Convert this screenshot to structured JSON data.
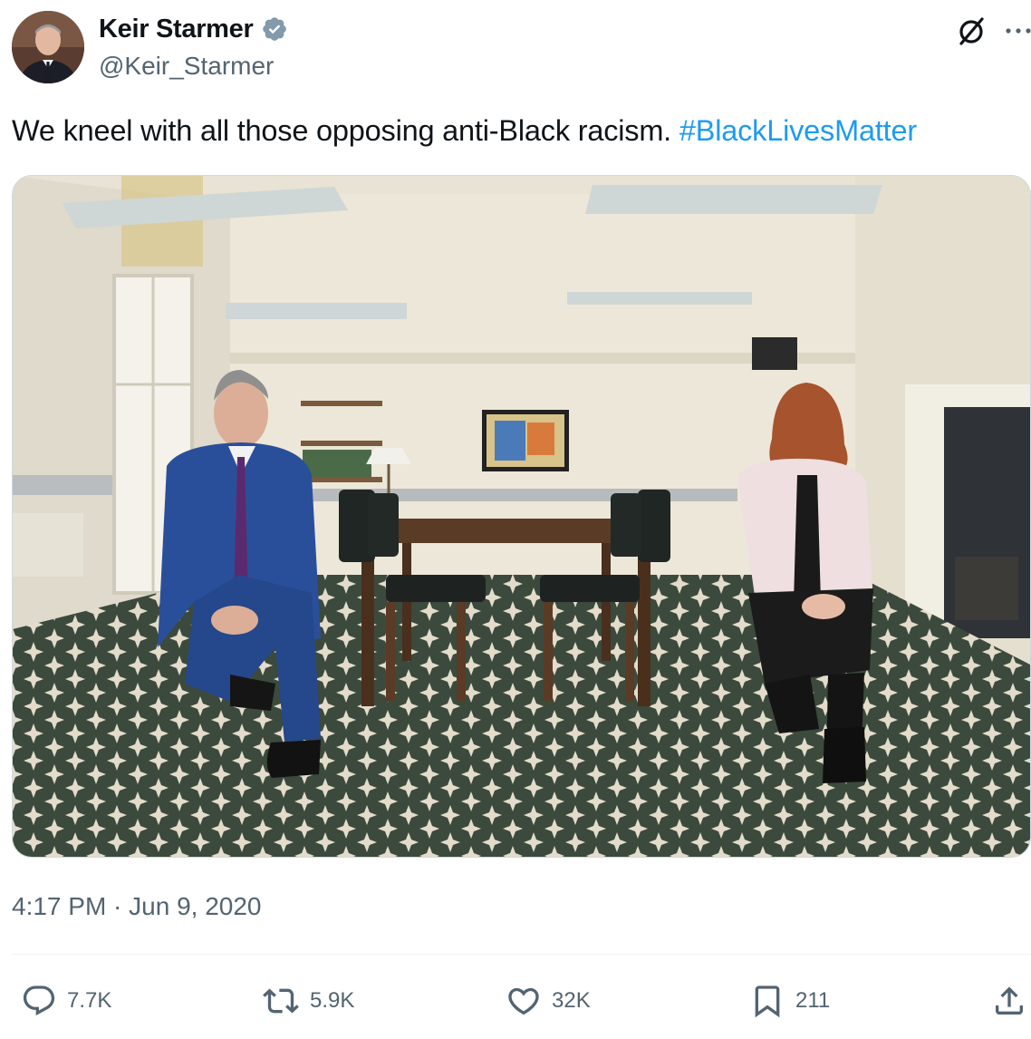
{
  "author": {
    "display_name": "Keir Starmer",
    "handle": "@Keir_Starmer",
    "verified_icon": "verified-badge-icon"
  },
  "header_actions": {
    "grok_icon": "slashed-circle-icon",
    "more_icon": "ellipsis-icon"
  },
  "tweet": {
    "text": "We kneel with all those opposing anti-Black racism.",
    "hashtag": "#BlackLivesMatter",
    "timestamp": "4:17 PM · Jun 9, 2020"
  },
  "media": {
    "kind": "photo",
    "subject": "two people kneeling on one knee either side of a long wooden conference table in a carpeted room"
  },
  "actions": {
    "replies": "7.7K",
    "reposts": "5.9K",
    "likes": "32K",
    "bookmarks": "211"
  },
  "colors": {
    "text": "#0f1419",
    "secondary": "#536471",
    "accent": "#1d9bf0",
    "border": "#cfd9de"
  }
}
